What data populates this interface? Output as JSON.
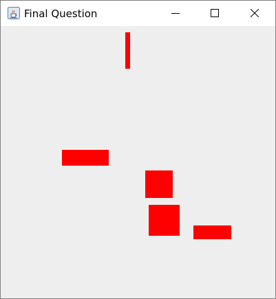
{
  "window": {
    "title": "Final Question",
    "app_icon": "java-cup-icon",
    "controls": {
      "minimize_icon": "minimize-icon",
      "maximize_icon": "maximize-icon",
      "close_icon": "close-icon"
    }
  },
  "canvas": {
    "background_color": "#eeeeee",
    "shape_color": "#ff0000",
    "shapes": [
      {
        "name": "shape-1",
        "kind": "rectangle"
      },
      {
        "name": "shape-2",
        "kind": "rectangle"
      },
      {
        "name": "shape-3",
        "kind": "rectangle"
      },
      {
        "name": "shape-4",
        "kind": "rectangle"
      },
      {
        "name": "shape-5",
        "kind": "rectangle"
      }
    ]
  }
}
